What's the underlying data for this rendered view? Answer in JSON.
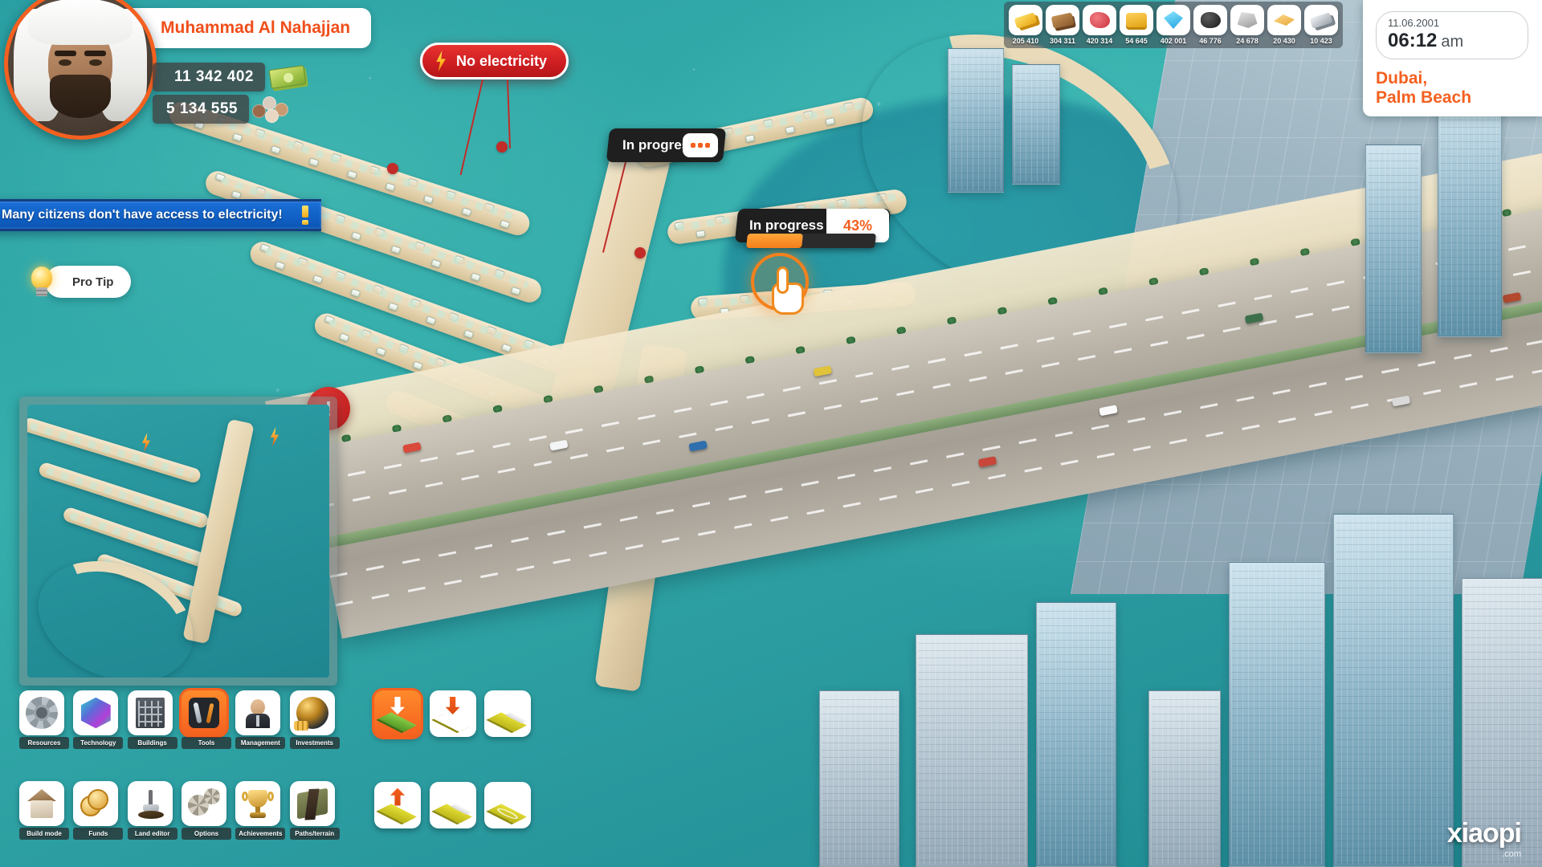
{
  "player": {
    "name": "Muhammad Al Nahajjan",
    "money": "11 342 402",
    "population": "5 134 555",
    "money_icon": "money-stack-icon",
    "population_icon": "citizens-icon",
    "avatar_icon": "player-portrait-avatar"
  },
  "alert": {
    "text": "Many citizens don't have access to electricity!",
    "icon": "exclamation-mark-icon",
    "color": "#1161c6"
  },
  "pro_tip": {
    "label": "Pro Tip",
    "icon": "lightbulb-icon"
  },
  "map_alert": {
    "symbol": "!",
    "color": "#c62323"
  },
  "callouts": {
    "no_electricity": {
      "label": "No electricity",
      "icon": "lightning-bolt-icon",
      "color": "#cf1f22"
    },
    "in_progress_1": {
      "label": "In progress",
      "indicator": "ellipsis-dots"
    },
    "in_progress_2": {
      "label": "In progress",
      "percent": "43%",
      "progress_value": 43
    }
  },
  "resources": [
    {
      "name": "gold-bars",
      "icon": "gold-bar-icon",
      "value": "205 410"
    },
    {
      "name": "wood",
      "icon": "wood-plank-icon",
      "value": "304 311"
    },
    {
      "name": "meat",
      "icon": "meat-icon",
      "value": "420 314"
    },
    {
      "name": "cheese",
      "icon": "cheese-icon",
      "value": "54 645"
    },
    {
      "name": "diamond",
      "icon": "diamond-icon",
      "value": "402 001"
    },
    {
      "name": "coal",
      "icon": "coal-icon",
      "value": "46 776"
    },
    {
      "name": "stone",
      "icon": "stone-icon",
      "value": "24 678"
    },
    {
      "name": "sand",
      "icon": "sand-icon",
      "value": "20 430"
    },
    {
      "name": "silver",
      "icon": "silver-bar-icon",
      "value": "10 423"
    }
  ],
  "clock": {
    "date": "11.06.2001",
    "time": "06:12",
    "meridiem": "am"
  },
  "location": {
    "name": "Dubai,\nPalm Beach",
    "line1": "Dubai,",
    "line2": "Palm Beach",
    "color": "#f4601f"
  },
  "toolbar": {
    "items": [
      {
        "label": "Resources",
        "icon": "gear-icon",
        "selected": false
      },
      {
        "label": "Technology",
        "icon": "tech-cube-icon",
        "selected": false
      },
      {
        "label": "Buildings",
        "icon": "office-building-icon",
        "selected": false
      },
      {
        "label": "Tools",
        "icon": "tools-icon",
        "selected": true
      },
      {
        "label": "Management",
        "icon": "manager-person-icon",
        "selected": false
      },
      {
        "label": "Investments",
        "icon": "globe-coins-icon",
        "selected": false
      },
      {
        "label": "Build mode",
        "icon": "house-icon",
        "selected": false
      },
      {
        "label": "Funds",
        "icon": "coins-icon",
        "selected": false
      },
      {
        "label": "Land editor",
        "icon": "shovel-icon",
        "selected": false
      },
      {
        "label": "Options",
        "icon": "gears-icon",
        "selected": false
      },
      {
        "label": "Achievements",
        "icon": "trophy-icon",
        "selected": false
      },
      {
        "label": "Paths/terrain",
        "icon": "path-terrain-icon",
        "selected": false
      }
    ]
  },
  "terrain_tools": {
    "items": [
      {
        "name": "lower-terrain",
        "icon": "arrow-down-terrain-icon",
        "selected": true
      },
      {
        "name": "lower-grid",
        "icon": "arrow-down-grid-icon",
        "selected": false
      },
      {
        "name": "flatten-slab",
        "icon": "flat-slab-icon",
        "selected": false
      },
      {
        "name": "raise-terrain",
        "icon": "arrow-up-terrain-icon",
        "selected": false
      },
      {
        "name": "raise-slab",
        "icon": "raised-slab-icon",
        "selected": false
      },
      {
        "name": "round-terrain",
        "icon": "round-tile-icon",
        "selected": false
      }
    ]
  },
  "minimap": {
    "name": "minimap",
    "markers": [
      "power-outage-bolt",
      "power-outage-bolt"
    ]
  },
  "watermark": {
    "main": "xiaopi",
    "sub": ".com"
  }
}
